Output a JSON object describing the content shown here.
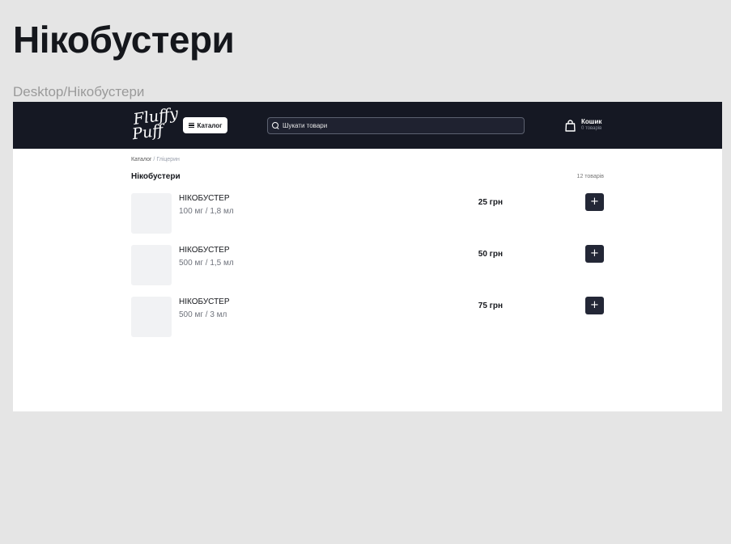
{
  "page": {
    "heading": "Нікобустери",
    "frame_label": "Desktop/Нікобустери"
  },
  "header": {
    "logo_line1": "Fluffy",
    "logo_line2": "Puff",
    "catalog_button": "Каталог",
    "search_placeholder": "Шукати товари",
    "cart_title": "Кошик",
    "cart_count": "0 товарів"
  },
  "breadcrumb": {
    "root": "Каталог",
    "separator": "/",
    "current": "Гліцерин"
  },
  "category": {
    "title": "Нікобустери",
    "items_count": "12 товарів"
  },
  "products": [
    {
      "name": "НІКОБУСТЕР",
      "variant": "100 мг / 1,8 мл",
      "price": "25 грн",
      "add_label": "+"
    },
    {
      "name": "НІКОБУСТЕР",
      "variant": "500 мг / 1,5 мл",
      "price": "50 грн",
      "add_label": "+"
    },
    {
      "name": "НІКОБУСТЕР",
      "variant": "500 мг / 3 мл",
      "price": "75 грн",
      "add_label": "+"
    }
  ],
  "colors": {
    "header_bg": "#151823",
    "accent_button": "#232736",
    "canvas_bg": "#e5e5e5"
  },
  "icons": [
    "menu-icon",
    "search-icon",
    "shopping-bag-icon",
    "plus-icon"
  ]
}
